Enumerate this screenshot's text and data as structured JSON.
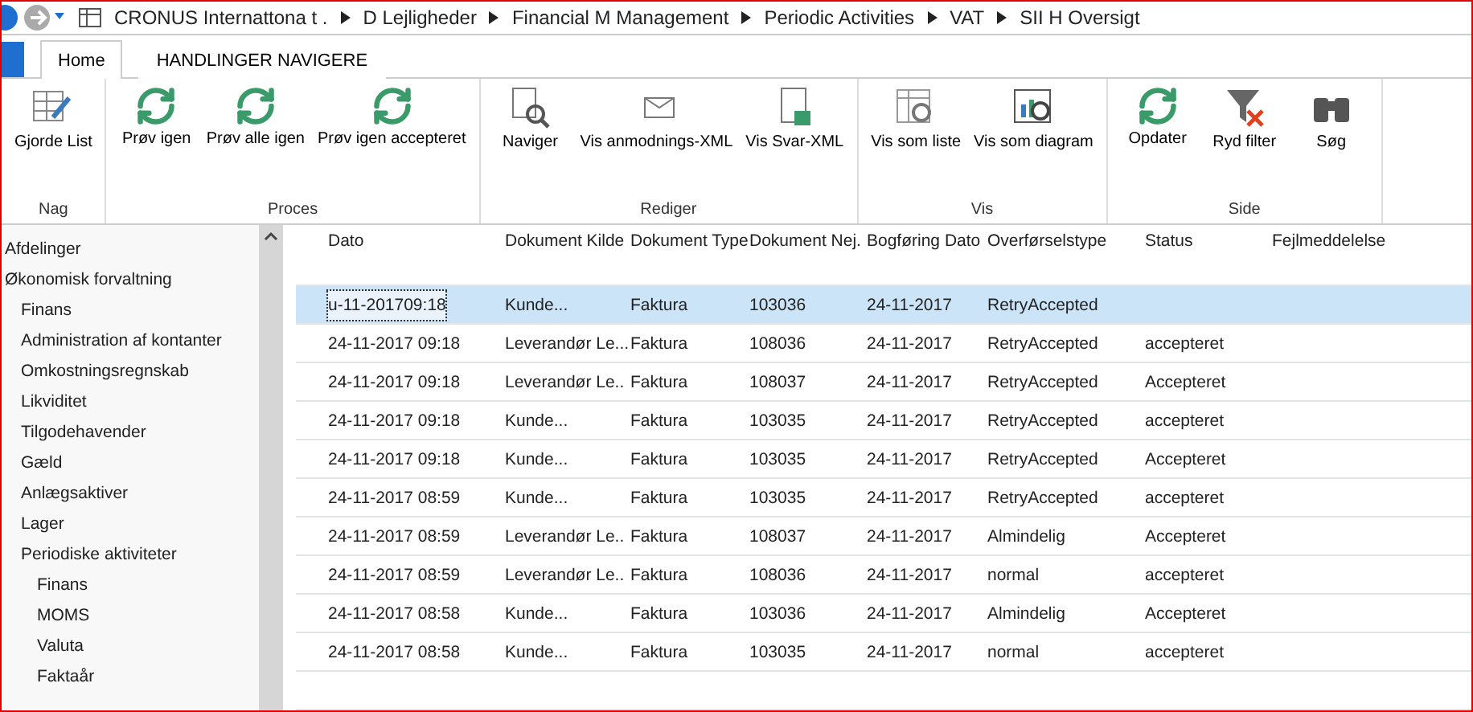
{
  "breadcrumb": [
    "CRONUS Internattona t .",
    "D Lejligheder",
    "Financial M Management",
    "Periodic Activities",
    "VAT",
    "SII H Oversigt"
  ],
  "tabs": [
    {
      "label": "Home",
      "selected": true
    },
    {
      "label": "HANDLINGER NAVIGERE",
      "selected": false
    }
  ],
  "ribbon_groups": [
    {
      "label": "Nag",
      "actions": [
        {
          "label": "Gjorde List",
          "kind": "edit"
        }
      ]
    },
    {
      "label": "Proces",
      "actions": [
        {
          "label": "Prøv igen",
          "kind": "refresh"
        },
        {
          "label": "Prøv alle igen",
          "kind": "refresh"
        },
        {
          "label": "Prøv igen accepteret",
          "kind": "refresh"
        }
      ]
    },
    {
      "label": "Rediger",
      "actions": [
        {
          "label": "Naviger",
          "kind": "navigate"
        },
        {
          "label": "Vis anmodnings-XML",
          "kind": "mail"
        },
        {
          "label": "Vis Svar-XML",
          "kind": "document"
        }
      ]
    },
    {
      "label": "Vis",
      "actions": [
        {
          "label": "Vis som liste",
          "kind": "list"
        },
        {
          "label": "Vis som diagram",
          "kind": "chart"
        }
      ]
    },
    {
      "label": "Side",
      "actions": [
        {
          "label": "Opdater",
          "kind": "refresh"
        },
        {
          "label": "Ryd filter",
          "kind": "filter"
        },
        {
          "label": "Søg",
          "kind": "binoculars"
        }
      ]
    }
  ],
  "sidebar": {
    "items": [
      {
        "label": "Afdelinger"
      },
      {
        "label": "Økonomisk forvaltning",
        "children": [
          {
            "label": "Finans"
          },
          {
            "label": "Administration af kontanter"
          },
          {
            "label": "Omkostningsregnskab"
          },
          {
            "label": "Likviditet"
          },
          {
            "label": "Tilgodehavender"
          },
          {
            "label": "Gæld"
          },
          {
            "label": "Anlægsaktiver"
          },
          {
            "label": "Lager"
          },
          {
            "label": "Periodiske aktiviteter",
            "children": [
              {
                "label": "Finans"
              },
              {
                "label": "MOMS"
              },
              {
                "label": "Valuta"
              },
              {
                "label": "Faktaår"
              }
            ]
          }
        ]
      }
    ]
  },
  "table": {
    "columns": [
      "Dato",
      "Dokument Kilde",
      "Dokument Type",
      "Dokument Nej.",
      "Bogføring Dato",
      "Overførselstype",
      "Status",
      "Fejlmeddelelse"
    ],
    "rows": [
      {
        "selected": true,
        "date": "u-11-201709:18",
        "source": "Kunde...",
        "type": "Faktura",
        "number": "103036",
        "posting_date": "24-11-2017",
        "transfer_type": "RetryAccepted"
      },
      {
        "selected": false,
        "date": "24-11-2017 09:18",
        "source": "Leverandør Le...",
        "type": "Faktura",
        "number": "108036",
        "posting_date": "24-11-2017",
        "transfer_type": "RetryAccepted",
        "status": "accepteret"
      },
      {
        "selected": false,
        "date": "24-11-2017 09:18",
        "source": "Leverandør Le..",
        "type": "Faktura",
        "number": "108037",
        "posting_date": "24-11-2017",
        "transfer_type": "RetryAccepted",
        "status": "Accepteret"
      },
      {
        "selected": false,
        "date": "24-11-2017 09:18",
        "source": "Kunde...",
        "type": "Faktura",
        "number": "103035",
        "posting_date": "24-11-2017",
        "transfer_type": "RetryAccepted",
        "status": "accepteret"
      },
      {
        "selected": false,
        "date": "24-11-2017 09:18",
        "source": "Kunde...",
        "type": "Faktura",
        "number": "103035",
        "posting_date": "24-11-2017",
        "transfer_type": "RetryAccepted",
        "status": "Accepteret"
      },
      {
        "selected": false,
        "date": "24-11-2017 08:59",
        "source": "Kunde...",
        "type": "Faktura",
        "number": "103035",
        "posting_date": "24-11-2017",
        "transfer_type": "RetryAccepted",
        "status": "accepteret"
      },
      {
        "selected": false,
        "date": "24-11-2017 08:59",
        "source": "Leverandør Le..",
        "type": "Faktura",
        "number": "108037",
        "posting_date": "24-11-2017",
        "transfer_type": "Almindelig",
        "status": "Accepteret"
      },
      {
        "selected": false,
        "date": "24-11-2017 08:59",
        "source": "Leverandør Le..",
        "type": "Faktura",
        "number": "108036",
        "posting_date": "24-11-2017",
        "transfer_type": "normal",
        "status": "accepteret"
      },
      {
        "selected": false,
        "date": "24-11-2017 08:58",
        "source": "Kunde...",
        "type": "Faktura",
        "number": "103036",
        "posting_date": "24-11-2017",
        "transfer_type": "Almindelig",
        "status": "Accepteret"
      },
      {
        "selected": false,
        "date": "24-11-2017 08:58",
        "source": "Kunde...",
        "type": "Faktura",
        "number": "103035",
        "posting_date": "24-11-2017",
        "transfer_type": "normal",
        "status": "accepteret"
      }
    ]
  }
}
